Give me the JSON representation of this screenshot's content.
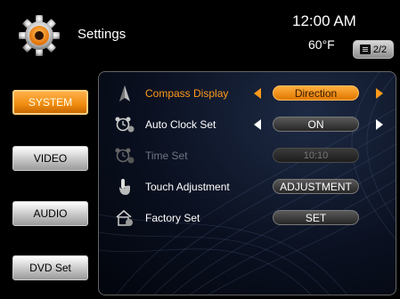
{
  "header": {
    "title": "Settings",
    "time": "12:00 AM",
    "temperature": "60°F",
    "page_indicator": "2/2",
    "icon": "gear-icon"
  },
  "sidebar": {
    "items": [
      {
        "label": "SYSTEM",
        "active": true
      },
      {
        "label": "VIDEO",
        "active": false
      },
      {
        "label": "AUDIO",
        "active": false
      },
      {
        "label": "DVD Set",
        "active": false
      }
    ]
  },
  "settings": {
    "rows": [
      {
        "label": "Compass Display",
        "value": "Direction",
        "icon": "compass-icon",
        "state": "highlighted",
        "has_arrows": true
      },
      {
        "label": "Auto Clock Set",
        "value": "ON",
        "icon": "alarm-clock-icon",
        "state": "normal",
        "has_arrows": true
      },
      {
        "label": "Time Set",
        "value": "10:10",
        "icon": "alarm-clock-icon",
        "state": "disabled",
        "has_arrows": false
      },
      {
        "label": "Touch Adjustment",
        "value": "ADJUSTMENT",
        "icon": "touch-hand-icon",
        "state": "normal",
        "has_arrows": false
      },
      {
        "label": "Factory Set",
        "value": "SET",
        "icon": "factory-home-icon",
        "state": "normal",
        "has_arrows": false
      }
    ]
  },
  "colors": {
    "accent": "#f08c10",
    "highlight_text": "#ff9a1a",
    "panel_bg": "#0a1020"
  }
}
